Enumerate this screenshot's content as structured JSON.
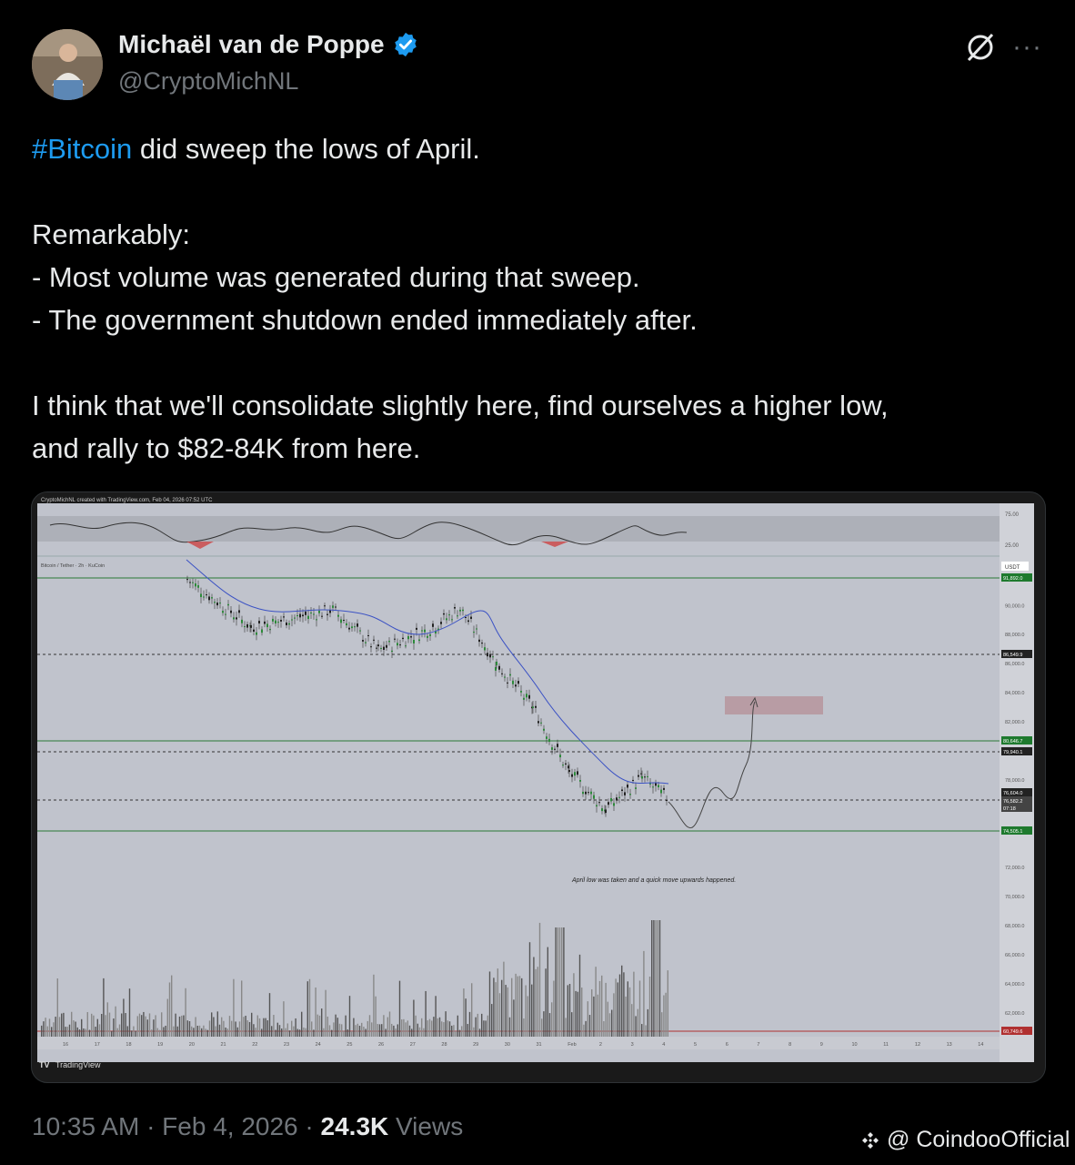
{
  "author": {
    "name": "Michaël van de Poppe",
    "handle": "@CryptoMichNL"
  },
  "tweet": {
    "line1_hashtag": "#Bitcoin",
    "line1_rest": " did sweep the lows of April.",
    "line2": "Remarkably:",
    "line3": "- Most volume was generated during that sweep.",
    "line4": "- The government shutdown ended immediately after.",
    "line5": "I think that we'll consolidate slightly here, find ourselves a higher low,",
    "line6": "and rally to $82-84K from here."
  },
  "chart": {
    "header_text": "CryptoMichNL created with TradingView.com, Feb 04, 2026 07:52 UTC",
    "symbol_text": "Bitcoin / Tether · 2h · KuCoin",
    "annotation": "April low was taken and a quick move upwards happened.",
    "brand": "TradingView",
    "rsi_labels": [
      "75.00",
      "25.00"
    ],
    "currency": "USDT",
    "price_ticks": [
      "90,000.0",
      "88,000.0",
      "86,000.0",
      "84,000.0",
      "82,000.0",
      "78,000.0",
      "72,000.0",
      "70,000.0",
      "68,000.0",
      "66,000.0",
      "64,000.0",
      "62,000.0"
    ],
    "price_tags": [
      {
        "label": "91,892.0",
        "color": "#1e7a2e"
      },
      {
        "label": "86,549.9",
        "color": "#222"
      },
      {
        "label": "80,646.7",
        "color": "#1e7a2e"
      },
      {
        "label": "79,940.1",
        "color": "#222"
      },
      {
        "label": "76,604.0",
        "color": "#222"
      },
      {
        "label": "76,582.2",
        "color": "#444"
      },
      {
        "label": "07:18",
        "color": "#444"
      },
      {
        "label": "74,505.1",
        "color": "#1e7a2e"
      },
      {
        "label": "60,749.6",
        "color": "#b03030"
      }
    ],
    "date_ticks": [
      "16",
      "17",
      "18",
      "19",
      "20",
      "21",
      "22",
      "23",
      "24",
      "25",
      "26",
      "27",
      "28",
      "29",
      "30",
      "31",
      "Feb",
      "2",
      "3",
      "4",
      "5",
      "6",
      "7",
      "8",
      "9",
      "10",
      "11",
      "12",
      "13",
      "14"
    ]
  },
  "chart_data": {
    "type": "line",
    "title": "",
    "xlabel": "",
    "ylabel": "",
    "x": [
      "Jan 19",
      "Jan 21",
      "Jan 24",
      "Jan 26",
      "Jan 28",
      "Jan 29",
      "Jan 30",
      "Jan 31",
      "Feb 1",
      "Feb 2",
      "Feb 3",
      "Feb 4"
    ],
    "series": [
      {
        "values": [
          91800,
          88500,
          89700,
          86900,
          88500,
          89800,
          86000,
          83000,
          78500,
          76000,
          78200,
          76600
        ]
      }
    ],
    "ylim": [
      60000,
      94000
    ],
    "levels": [
      91892.0,
      86549.9,
      80646.7,
      79940.1,
      76604.0,
      74505.1,
      60749.6
    ],
    "target_zone": [
      82800,
      84000
    ]
  },
  "meta": {
    "time": "10:35 AM · Feb 4, 2026 · ",
    "views_count": "24.3K",
    "views_label": " Views"
  },
  "watermark": "@ CoindooOfficial"
}
